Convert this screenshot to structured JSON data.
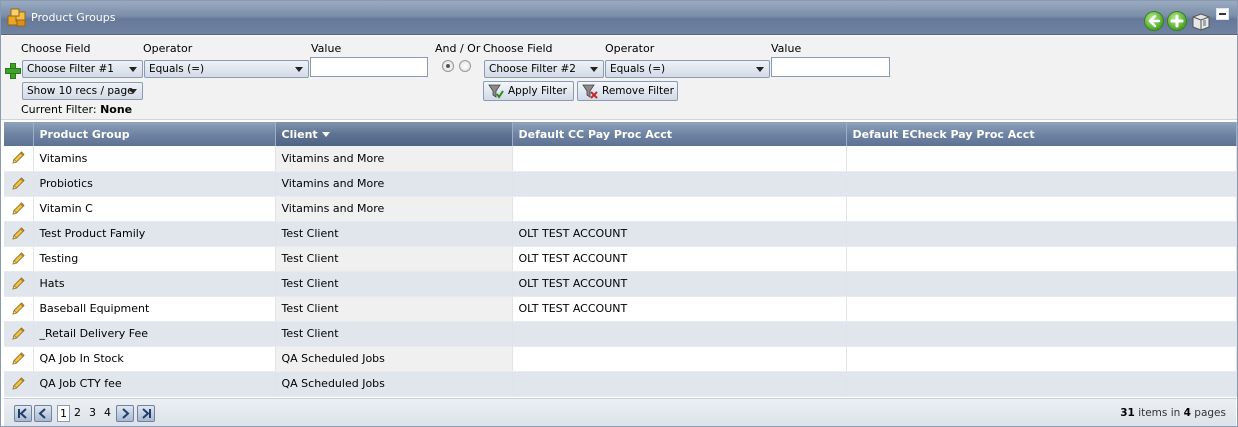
{
  "header": {
    "title": "Product Groups"
  },
  "filters": {
    "left": {
      "choose_field_label": "Choose Field",
      "operator_label": "Operator",
      "value_label": "Value",
      "field_selected": "Choose Filter #1",
      "operator_selected": "Equals (=)",
      "value": ""
    },
    "and_or_label": "And / Or",
    "right": {
      "choose_field_label": "Choose Field",
      "operator_label": "Operator",
      "value_label": "Value",
      "field_selected": "Choose Filter #2",
      "operator_selected": "Equals (=)",
      "value": ""
    },
    "page_size_selected": "Show 10 recs / page",
    "current_filter_label": "Current Filter:",
    "current_filter_value": "None",
    "apply_label": "Apply Filter",
    "remove_label": "Remove Filter"
  },
  "grid": {
    "columns": [
      "Product Group",
      "Client",
      "Default CC Pay Proc Acct",
      "Default ECheck Pay Proc Acct"
    ],
    "sorted_column": "Client",
    "rows": [
      {
        "product_group": "Vitamins",
        "client": "Vitamins and More",
        "cc_acct": "",
        "echeck_acct": ""
      },
      {
        "product_group": "Probiotics",
        "client": "Vitamins and More",
        "cc_acct": "",
        "echeck_acct": ""
      },
      {
        "product_group": "Vitamin C",
        "client": "Vitamins and More",
        "cc_acct": "",
        "echeck_acct": ""
      },
      {
        "product_group": "Test Product Family",
        "client": "Test Client",
        "cc_acct": "OLT TEST ACCOUNT",
        "echeck_acct": ""
      },
      {
        "product_group": "Testing",
        "client": "Test Client",
        "cc_acct": "OLT TEST ACCOUNT",
        "echeck_acct": ""
      },
      {
        "product_group": "Hats",
        "client": "Test Client",
        "cc_acct": "OLT TEST ACCOUNT",
        "echeck_acct": ""
      },
      {
        "product_group": "Baseball Equipment",
        "client": "Test Client",
        "cc_acct": "OLT TEST ACCOUNT",
        "echeck_acct": ""
      },
      {
        "product_group": "_Retail Delivery Fee",
        "client": "Test Client",
        "cc_acct": "",
        "echeck_acct": ""
      },
      {
        "product_group": "QA Job In Stock",
        "client": "QA Scheduled Jobs",
        "cc_acct": "",
        "echeck_acct": ""
      },
      {
        "product_group": "QA Job CTY fee",
        "client": "QA Scheduled Jobs",
        "cc_acct": "",
        "echeck_acct": ""
      }
    ]
  },
  "pager": {
    "pages": [
      "1",
      "2",
      "3",
      "4"
    ],
    "current_page": "1",
    "total_items": "31",
    "items_in_text": "items in",
    "total_pages": "4",
    "pages_text": "pages"
  },
  "colors": {
    "titlebar": "#7b8ea8",
    "header": "#6f84a3",
    "alt_row": "#e1e6ed",
    "accent_green": "#4ea52a"
  }
}
